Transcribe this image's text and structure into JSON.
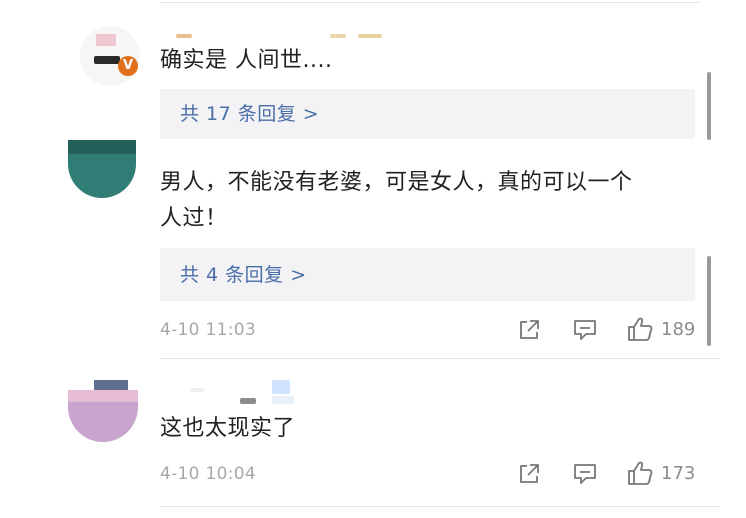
{
  "comments": [
    {
      "text": "确实是 人间世....",
      "verified_badge": "V",
      "replies_label": "共 17 条回复 >"
    },
    {
      "text_line1": "男人，不能没有老婆，可是女人，真的可以一个",
      "text_line2": "人过！",
      "replies_label": "共 4 条回复 >",
      "timestamp": "4-10 11:03",
      "likes": "189"
    },
    {
      "text": "这也太现实了",
      "timestamp": "4-10 10:04",
      "likes": "173"
    }
  ],
  "colors": {
    "reply_link": "#4a6ea8",
    "reply_bg": "#f3f3f5",
    "verified_badge": "#e0701b",
    "timestamp": "#a8a8a8"
  },
  "icons": [
    "share-icon",
    "comment-icon",
    "like-icon",
    "verified-badge-icon"
  ]
}
